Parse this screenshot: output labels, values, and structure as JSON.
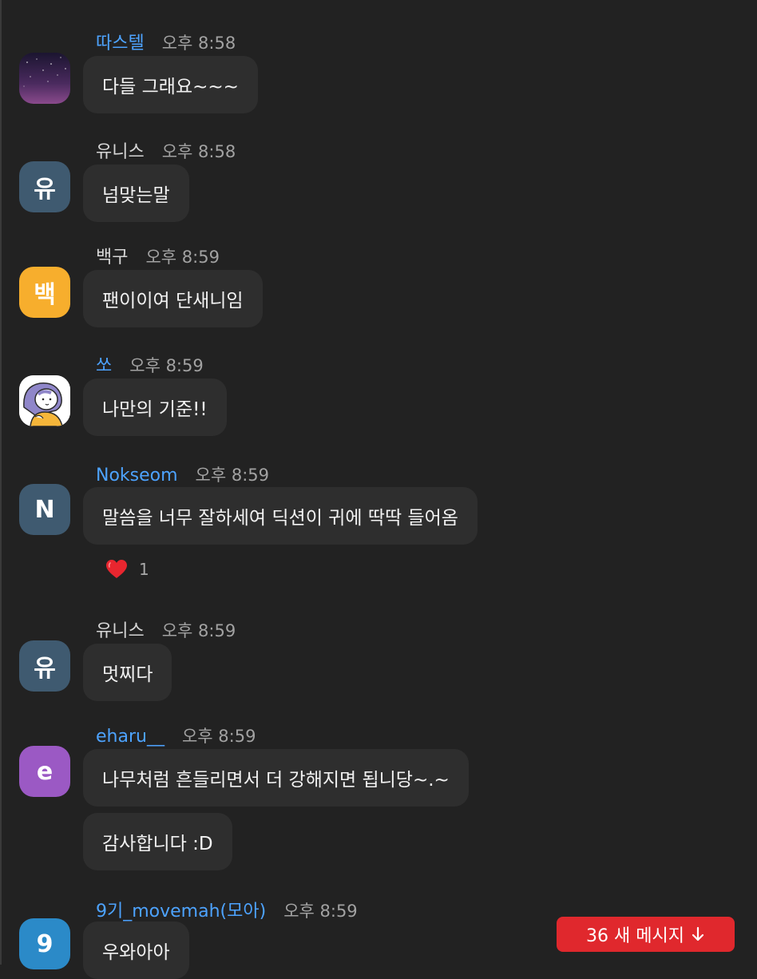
{
  "messages": [
    {
      "name": "따스텔",
      "time": "오후 8:58",
      "avatar_type": "image",
      "avatar_icon": "night-sky-avatar",
      "bubbles": [
        "다들 그래요~~~"
      ]
    },
    {
      "name": "유니스",
      "time": "오후 8:58",
      "avatar_type": "initial",
      "avatar_text": "유",
      "avatar_color": "#3f5a70",
      "bubbles": [
        "넘맞는말"
      ]
    },
    {
      "name": "백구",
      "time": "오후 8:59",
      "avatar_type": "initial",
      "avatar_text": "백",
      "avatar_color": "#f7ae2d",
      "bubbles": [
        "팬이이여 단새니임"
      ]
    },
    {
      "name": "쏘",
      "time": "오후 8:59",
      "avatar_type": "image",
      "avatar_icon": "cartoon-girl-avatar",
      "bubbles": [
        "나만의 기준!!"
      ]
    },
    {
      "name": "Nokseom",
      "time": "오후 8:59",
      "avatar_type": "initial",
      "avatar_text": "N",
      "avatar_color": "#3f5a70",
      "bubbles": [
        "말씀을 너무 잘하세여 딕션이 귀에 딱딱 들어옴"
      ],
      "reaction": {
        "icon": "heart-icon",
        "emoji": "❤️",
        "count": "1"
      }
    },
    {
      "name": "유니스",
      "time": "오후 8:59",
      "avatar_type": "initial",
      "avatar_text": "유",
      "avatar_color": "#3f5a70",
      "bubbles": [
        "멋찌다"
      ]
    },
    {
      "name": "eharu__",
      "time": "오후 8:59",
      "avatar_type": "initial",
      "avatar_text": "e",
      "avatar_color": "#9b59c4",
      "bubbles": [
        "나무처럼 흔들리면서 더 강해지면 됩니당~.~",
        "감사합니다 :D"
      ]
    },
    {
      "name": "9기_movemah(모아)",
      "time": "오후 8:59",
      "avatar_type": "initial",
      "avatar_text": "9",
      "avatar_color": "#2b8ac8",
      "bubbles": [
        "우와아아"
      ]
    }
  ],
  "colors": {
    "name_blue": "#4da3ff",
    "name_gray": "#d6d6d6",
    "badge_red": "#e0282d"
  },
  "new_messages_button": {
    "label": "36 새 메시지",
    "icon": "arrow-down-icon"
  }
}
